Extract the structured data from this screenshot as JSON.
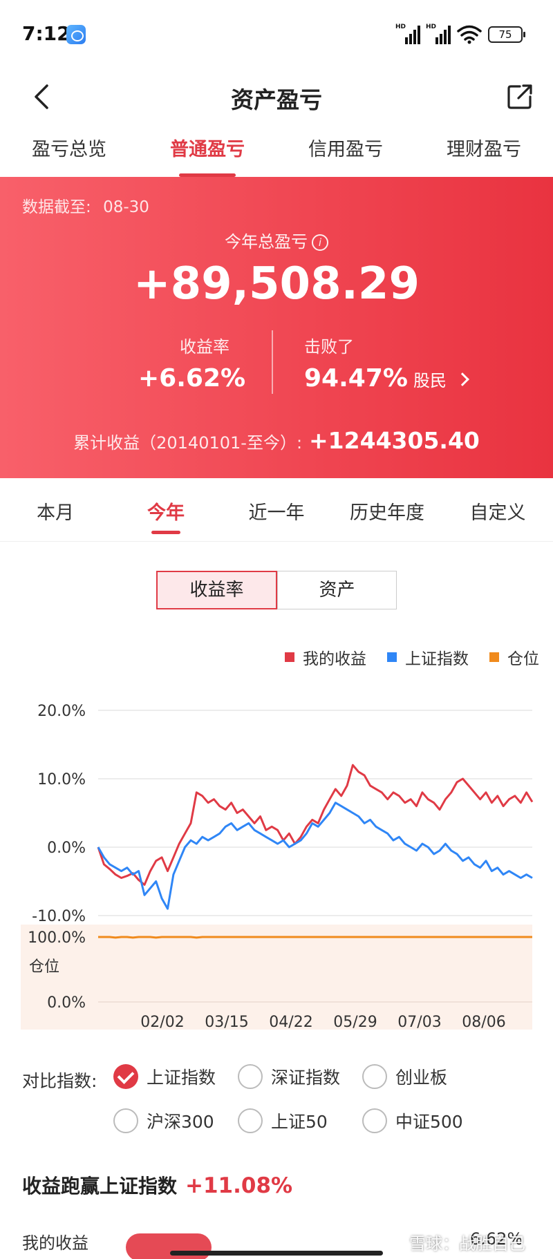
{
  "status_bar": {
    "time": "7:12",
    "battery": "75",
    "signal_tag": "HD"
  },
  "nav": {
    "title": "资产盈亏"
  },
  "main_tabs": [
    {
      "label": "盈亏总览",
      "active": false
    },
    {
      "label": "普通盈亏",
      "active": true
    },
    {
      "label": "信用盈亏",
      "active": false
    },
    {
      "label": "理财盈亏",
      "active": false
    }
  ],
  "hero": {
    "date_label": "数据截至:",
    "date_value": "08-30",
    "year_label": "今年总盈亏",
    "total": "+89,508.29",
    "return_label": "收益率",
    "return_value": "+6.62%",
    "beat_label": "击败了",
    "beat_value": "94.47%",
    "beat_unit": "股民",
    "cumulative_label": "累计收益（20140101-至今）:",
    "cumulative_value": "+1244305.40"
  },
  "period_tabs": [
    {
      "label": "本月",
      "active": false
    },
    {
      "label": "今年",
      "active": true
    },
    {
      "label": "近一年",
      "active": false
    },
    {
      "label": "历史年度",
      "active": false
    },
    {
      "label": "自定义",
      "active": false
    }
  ],
  "toggle": {
    "return_rate": "收益率",
    "assets": "资产"
  },
  "legend": [
    {
      "name": "我的收益",
      "color": "#e03a45"
    },
    {
      "name": "上证指数",
      "color": "#2f86f6"
    },
    {
      "name": "仓位",
      "color": "#f08a1c"
    }
  ],
  "chart_data": {
    "type": "line",
    "x_ticks": [
      "02/02",
      "03/15",
      "04/22",
      "05/29",
      "07/03",
      "08/06"
    ],
    "y_ticks": [
      "20.0%",
      "10.0%",
      "0.0%",
      "-10.0%"
    ],
    "ylim": [
      -10,
      20
    ],
    "position_ticks": [
      "100.0%",
      "0.0%"
    ],
    "position_label": "仓位",
    "position_ylim": [
      0,
      100
    ],
    "grid": true,
    "series": [
      {
        "name": "我的收益",
        "color": "#e03a45",
        "values": [
          0,
          -2.5,
          -3.2,
          -4.0,
          -4.5,
          -4.2,
          -3.8,
          -4.8,
          -5.5,
          -3.5,
          -2.0,
          -1.5,
          -3.5,
          -1.5,
          0.5,
          2.0,
          3.5,
          8.0,
          7.5,
          6.5,
          7.0,
          6.0,
          5.5,
          6.5,
          5.0,
          5.5,
          4.5,
          3.5,
          4.5,
          2.5,
          3.0,
          2.5,
          1.0,
          2.0,
          0.5,
          1.5,
          3.0,
          4.0,
          3.5,
          5.5,
          7.0,
          8.5,
          7.5,
          9.0,
          12.0,
          11.0,
          10.5,
          9.0,
          8.5,
          8.0,
          7.0,
          8.0,
          7.5,
          6.5,
          7.0,
          6.0,
          8.0,
          7.0,
          6.5,
          5.5,
          7.0,
          8.0,
          9.5,
          10.0,
          9.0,
          8.0,
          7.0,
          8.0,
          6.5,
          7.5,
          6.0,
          7.0,
          7.5,
          6.5,
          8.0,
          6.62
        ]
      },
      {
        "name": "上证指数",
        "color": "#2f86f6",
        "values": [
          0,
          -1.5,
          -2.5,
          -3.0,
          -3.5,
          -3.0,
          -4.0,
          -3.5,
          -7.0,
          -6.0,
          -5.0,
          -7.5,
          -9.0,
          -4.0,
          -2.0,
          0.0,
          1.0,
          0.5,
          1.5,
          1.0,
          1.5,
          2.0,
          3.0,
          3.5,
          2.5,
          3.0,
          3.5,
          2.5,
          2.0,
          1.5,
          1.0,
          0.5,
          1.0,
          0.0,
          0.5,
          1.0,
          2.0,
          3.5,
          3.0,
          4.0,
          5.0,
          6.5,
          6.0,
          5.5,
          5.0,
          4.5,
          3.5,
          4.0,
          3.0,
          2.5,
          2.0,
          1.0,
          1.5,
          0.5,
          0.0,
          -0.5,
          0.5,
          0.0,
          -1.0,
          -0.5,
          0.5,
          -0.5,
          -1.0,
          -2.0,
          -1.5,
          -2.5,
          -3.0,
          -2.0,
          -3.5,
          -3.0,
          -4.0,
          -3.5,
          -4.0,
          -4.5,
          -4.0,
          -4.5
        ]
      },
      {
        "name": "仓位",
        "color": "#f08a1c",
        "values": [
          100,
          100,
          100,
          99,
          100,
          100,
          99,
          100,
          100,
          100,
          99,
          100,
          100,
          100,
          100,
          100,
          100,
          99,
          100,
          100,
          100,
          100,
          100,
          100,
          100,
          100,
          100,
          100,
          100,
          100,
          100,
          100,
          100,
          100,
          100,
          100,
          100,
          100,
          100,
          100,
          100,
          100,
          100,
          100,
          100,
          100,
          100,
          100,
          100,
          100,
          100,
          100,
          100,
          100,
          100,
          100,
          100,
          100,
          100,
          100,
          100,
          100,
          100,
          100,
          100,
          100,
          100,
          100,
          100,
          100,
          100,
          100,
          100,
          100,
          100,
          100
        ]
      }
    ]
  },
  "compare": {
    "label": "对比指数:",
    "options": [
      {
        "label": "上证指数",
        "checked": true
      },
      {
        "label": "深证指数",
        "checked": false
      },
      {
        "label": "创业板",
        "checked": false
      },
      {
        "label": "沪深300",
        "checked": false
      },
      {
        "label": "上证50",
        "checked": false
      },
      {
        "label": "中证500",
        "checked": false
      }
    ]
  },
  "outperform": {
    "label": "收益跑赢上证指数",
    "value": "+11.08%"
  },
  "partial_row": {
    "label": "我的收益",
    "value": "6.62%"
  },
  "watermark": "雪球：战胜自己"
}
